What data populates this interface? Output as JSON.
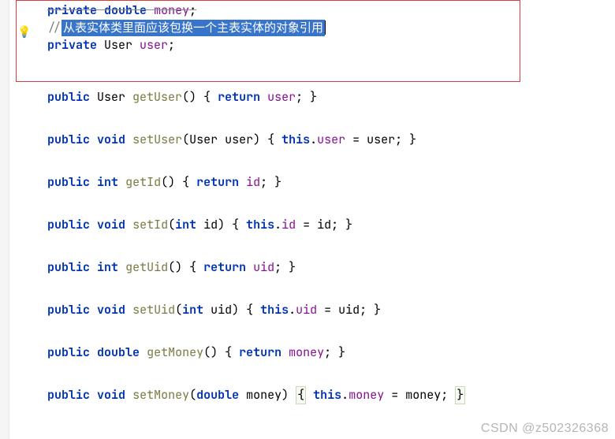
{
  "lines": {
    "l0a": "private",
    "l0b": " ",
    "l0c": "double",
    "l0d": " ",
    "l0e": "money",
    "l0f": ";",
    "l1a": "//",
    "l1b": "从表实体类里面应该包换一个主表实体的对象引用",
    "l2a": "private",
    "l2b": " User ",
    "l2c": "user",
    "l2d": ";",
    "l3a": "public",
    "l3b": " User ",
    "l3c": "getUser",
    "l3d": "() { ",
    "l3e": "return",
    "l3f": " ",
    "l3g": "user",
    "l3h": "; }",
    "l4a": "public",
    "l4b": " ",
    "l4c": "void",
    "l4d": " ",
    "l4e": "setUser",
    "l4f": "(User user) { ",
    "l4g": "this",
    "l4h": ".",
    "l4i": "user",
    "l4j": " = user; }",
    "l5a": "public",
    "l5b": " ",
    "l5c": "int",
    "l5d": " ",
    "l5e": "getId",
    "l5f": "() { ",
    "l5g": "return",
    "l5h": " ",
    "l5i": "id",
    "l5j": "; }",
    "l6a": "public",
    "l6b": " ",
    "l6c": "void",
    "l6d": " ",
    "l6e": "setId",
    "l6f": "(",
    "l6g": "int",
    "l6h": " id) { ",
    "l6i": "this",
    "l6j": ".",
    "l6k": "id",
    "l6l": " = id; }",
    "l7a": "public",
    "l7b": " ",
    "l7c": "int",
    "l7d": " ",
    "l7e": "getUid",
    "l7f": "() { ",
    "l7g": "return",
    "l7h": " ",
    "l7i": "uid",
    "l7j": "; }",
    "l8a": "public",
    "l8b": " ",
    "l8c": "void",
    "l8d": " ",
    "l8e": "setUid",
    "l8f": "(",
    "l8g": "int",
    "l8h": " uid) { ",
    "l8i": "this",
    "l8j": ".",
    "l8k": "uid",
    "l8l": " = uid; }",
    "l9a": "public",
    "l9b": " ",
    "l9c": "double",
    "l9d": " ",
    "l9e": "getMoney",
    "l9f": "() { ",
    "l9g": "return",
    "l9h": " ",
    "l9i": "money",
    "l9j": "; }",
    "l10a": "public",
    "l10b": " ",
    "l10c": "void",
    "l10d": " ",
    "l10e": "setMoney",
    "l10f": "(",
    "l10g": "double",
    "l10h": " money) ",
    "l10i": "{",
    "l10j": " ",
    "l10k": "this",
    "l10l": ".",
    "l10m": "money",
    "l10n": " = money; ",
    "l10o": "}"
  },
  "watermark": "CSDN @z502326368"
}
